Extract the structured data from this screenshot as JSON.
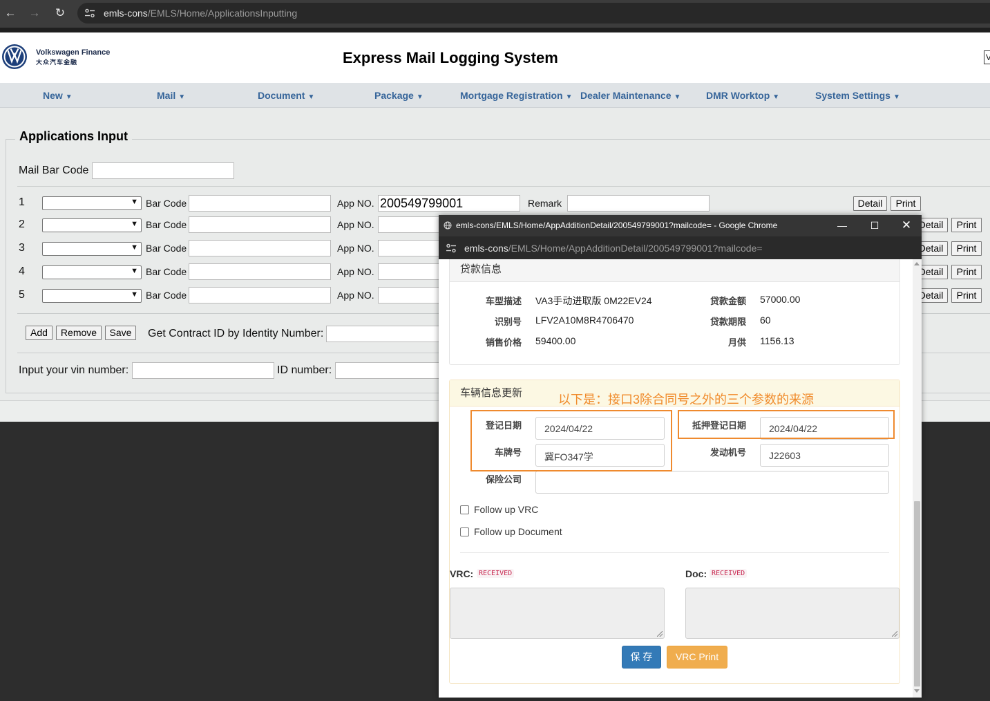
{
  "browser": {
    "url_host": "emls-cons",
    "url_path": "/EMLS/Home/ApplicationsInputting"
  },
  "header": {
    "brand_line1": "Volkswagen Finance",
    "brand_line2": "大众汽车金融",
    "title": "Express Mail Logging System",
    "edge_char": "V"
  },
  "menu": [
    {
      "label": "New"
    },
    {
      "label": "Mail"
    },
    {
      "label": "Document"
    },
    {
      "label": "Package"
    },
    {
      "label": "Mortgage Registration"
    },
    {
      "label": "Dealer Maintenance"
    },
    {
      "label": "DMR Worktop"
    },
    {
      "label": "System Settings"
    }
  ],
  "caret": "▼",
  "form": {
    "legend": "Applications Input",
    "mail_bar_code_label": "Mail Bar Code",
    "mail_bar_code_value": "",
    "bar_code_label": "Bar Code",
    "app_no_label": "App NO.",
    "remark_label": "Remark",
    "detail_label": "Detail",
    "print_label": "Print",
    "rows": [
      {
        "num": "1",
        "app_no": "200549799001"
      },
      {
        "num": "2",
        "app_no": ""
      },
      {
        "num": "3",
        "app_no": ""
      },
      {
        "num": "4",
        "app_no": ""
      },
      {
        "num": "5",
        "app_no": ""
      }
    ],
    "add_label": "Add",
    "remove_label": "Remove",
    "save_label": "Save",
    "contract_label": "Get Contract ID by Identity Number:",
    "vin_label": "Input your vin number:",
    "id_label": "ID number:"
  },
  "popup": {
    "title": "emls-cons/EMLS/Home/AppAdditionDetail/200549799001?mailcode= - Google Chrome",
    "url_host": "emls-cons",
    "url_path": "/EMLS/Home/AppAdditionDetail/200549799001?mailcode=",
    "loan_panel": {
      "heading": "贷款信息",
      "car_desc_label": "车型描述",
      "car_desc": "VA3手动进取版 0M22EV24",
      "loan_amount_label": "贷款金额",
      "loan_amount": "57000.00",
      "vin_label": "识别号",
      "vin": "LFV2A10M8R4706470",
      "loan_term_label": "贷款期限",
      "loan_term": "60",
      "price_label": "销售价格",
      "price": "59400.00",
      "monthly_label": "月供",
      "monthly": "1156.13"
    },
    "vehicle_panel": {
      "heading": "车辆信息更新",
      "annotation": "以下是：接口3除合同号之外的三个参数的来源",
      "reg_date_label": "登记日期",
      "reg_date": "2024/04/22",
      "mortgage_date_label": "抵押登记日期",
      "mortgage_date": "2024/04/22",
      "plate_label": "车牌号",
      "plate": "冀FO347学",
      "engine_label": "发动机号",
      "engine": "J22603",
      "insurer_label": "保险公司",
      "insurer": "",
      "follow_vrc": "Follow up VRC",
      "follow_doc": "Follow up Document",
      "vrc_label": "VRC:",
      "vrc_status": "RECEIVED",
      "doc_label": "Doc:",
      "doc_status": "RECEIVED",
      "save_label": "保 存",
      "vrc_print_label": "VRC Print"
    }
  }
}
